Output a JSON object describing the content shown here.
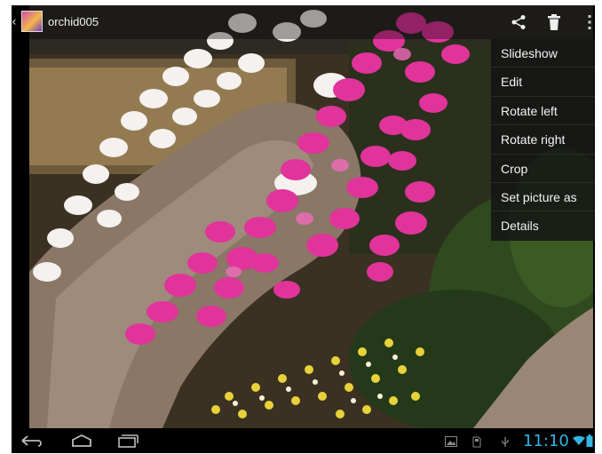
{
  "action_bar": {
    "back_icon": "back-caret-icon",
    "app_icon": "gallery-thumbnail-icon",
    "title": "orchid005",
    "actions": [
      "share-icon",
      "delete-icon",
      "overflow-menu-icon"
    ]
  },
  "menu": {
    "items": [
      {
        "label": "Slideshow"
      },
      {
        "label": "Edit"
      },
      {
        "label": "Rotate left"
      },
      {
        "label": "Rotate right"
      },
      {
        "label": "Crop"
      },
      {
        "label": "Set picture as"
      },
      {
        "label": "Details"
      }
    ]
  },
  "system_bar": {
    "nav": [
      "back-icon",
      "home-icon",
      "recent-apps-icon"
    ],
    "notifications": [
      "gallery-notification-icon",
      "sd-card-icon",
      "usb-icon"
    ],
    "time": "11:10",
    "status": [
      "wifi-icon",
      "battery-icon"
    ],
    "clock_color": "#33b5e5"
  }
}
